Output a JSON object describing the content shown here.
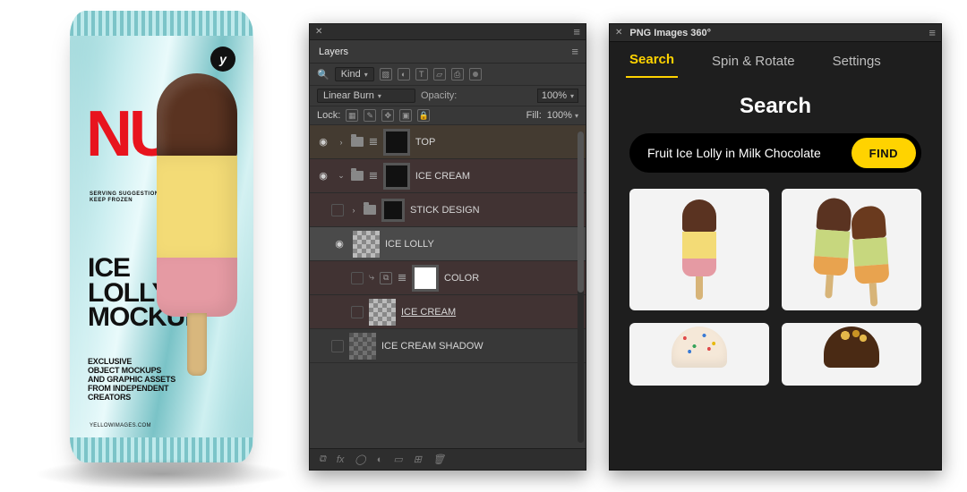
{
  "product": {
    "logo": "y",
    "brand_line1": "NU",
    "serving": "SERVING SUGGESTION\nKEEP FROZEN",
    "title": "ICE\nLOLLY\nMOCKUP",
    "blurb": "EXCLUSIVE\nOBJECT MOCKUPS\nAND GRAPHIC ASSETS\nFROM INDEPENDENT\nCREATORS",
    "site": "YELLOWIMAGES.COM"
  },
  "layers_panel": {
    "tab": "Layers",
    "filter_label": "Kind",
    "blend_mode": "Linear Burn",
    "opacity_label": "Opacity:",
    "opacity_value": "100%",
    "lock_label": "Lock:",
    "fill_label": "Fill:",
    "fill_value": "100%",
    "rows": [
      {
        "name": "TOP"
      },
      {
        "name": "ICE CREAM"
      },
      {
        "name": "STICK DESIGN"
      },
      {
        "name": "ICE LOLLY"
      },
      {
        "name": "COLOR"
      },
      {
        "name": "ICE CREAM"
      },
      {
        "name": "ICE CREAM SHADOW"
      }
    ],
    "footer_fx": "fx"
  },
  "plugin": {
    "title": "PNG Images 360°",
    "tabs": {
      "search": "Search",
      "spin": "Spin & Rotate",
      "settings": "Settings"
    },
    "heading": "Search",
    "search_value": "Fruit Ice Lolly in Milk Chocolate",
    "find": "FIND"
  }
}
